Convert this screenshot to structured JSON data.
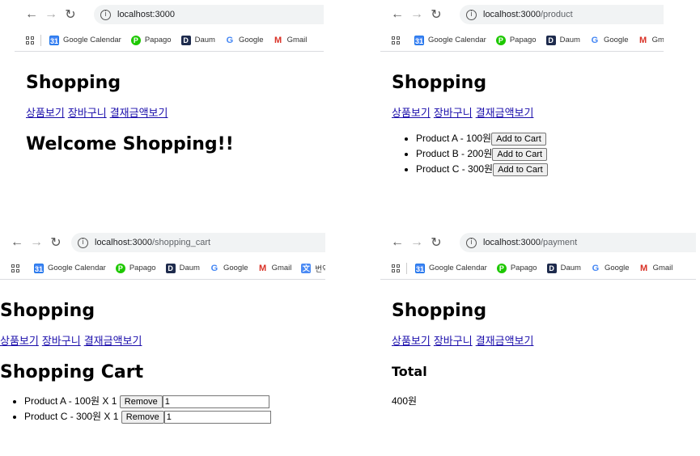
{
  "browser": {
    "bookmarks": [
      "Google Calendar",
      "Papago",
      "Daum",
      "Google",
      "Gmail"
    ],
    "extra_bookmark": "번역"
  },
  "panels": {
    "home": {
      "url_host": "localhost:3000",
      "url_path": "",
      "heading": "Welcome Shopping!!"
    },
    "product": {
      "url_host": "localhost:3000",
      "url_path": "/product",
      "add_label": "Add to Cart",
      "items": [
        "Product A - 100원",
        "Product B - 200원",
        "Product C - 300원"
      ]
    },
    "cart": {
      "url_host": "localhost:3000",
      "url_path": "/shopping_cart",
      "heading": "Shopping Cart",
      "remove_label": "Remove",
      "items": [
        {
          "label": "Product A - 100원 X 1",
          "qty": "1"
        },
        {
          "label": "Product C - 300원 X 1",
          "qty": "1"
        }
      ]
    },
    "payment": {
      "url_host": "localhost:3000",
      "url_path": "/payment",
      "total_label": "Total",
      "total_value": "400원"
    }
  },
  "site": {
    "title": "Shopping",
    "nav": [
      "상품보기",
      "장바구니",
      "결재금액보기"
    ]
  }
}
